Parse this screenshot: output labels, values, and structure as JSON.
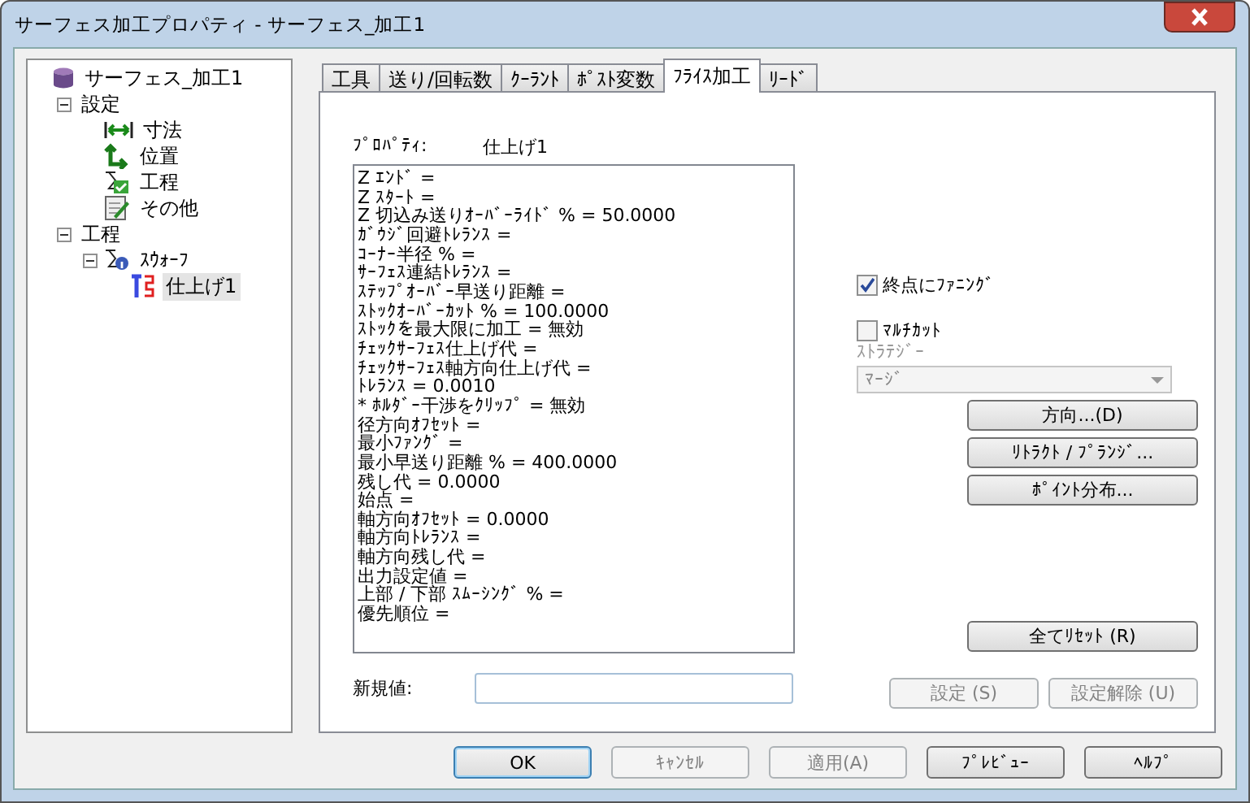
{
  "window": {
    "title": "サーフェス加工プロパティ - サーフェス_加工1"
  },
  "tree": [
    {
      "label": "サーフェス_加工1",
      "kind": "database",
      "selected": false,
      "children": [
        {
          "label": "設定",
          "expanded": true,
          "selected": false,
          "children": [
            {
              "label": "寸法",
              "kind": "dimension",
              "selected": false
            },
            {
              "label": "位置",
              "kind": "position",
              "selected": false
            },
            {
              "label": "工程",
              "kind": "process",
              "selected": false
            },
            {
              "label": "その他",
              "kind": "other",
              "selected": false
            }
          ]
        },
        {
          "label": "工程",
          "expanded": true,
          "selected": false,
          "children": [
            {
              "label": "ｽｳｫｰﾌ",
              "kind": "swarf",
              "expanded": true,
              "selected": false,
              "children": [
                {
                  "label": "仕上げ1",
                  "kind": "finish",
                  "selected": true
                }
              ]
            }
          ]
        }
      ]
    }
  ],
  "tabs": [
    {
      "label": "工具",
      "selected": false
    },
    {
      "label": "送り/回転数",
      "selected": false
    },
    {
      "label": "ｸｰﾗﾝﾄ",
      "selected": false
    },
    {
      "label": "ﾎﾟｽﾄ変数",
      "selected": false
    },
    {
      "label": "ﾌﾗｲｽ加工",
      "selected": true
    },
    {
      "label": "ﾘｰﾄﾞ",
      "selected": false
    }
  ],
  "property": {
    "label": "ﾌﾟﾛﾊﾟﾃｨ:",
    "value": "仕上げ1"
  },
  "properties": [
    "Z ｴﾝﾄﾞ =",
    "Z ｽﾀｰﾄ =",
    "Z 切込み送りｵｰﾊﾞｰﾗｲﾄﾞ % = 50.0000",
    "ｶﾞｳｼﾞ回避ﾄﾚﾗﾝｽ =",
    "ｺｰﾅｰ半径 % =",
    "ｻｰﾌｪｽ連結ﾄﾚﾗﾝｽ =",
    "ｽﾃｯﾌﾟｵｰﾊﾞｰ早送り距離 =",
    "ｽﾄｯｸｵｰﾊﾞｰｶｯﾄ % = 100.0000",
    "ｽﾄｯｸを最大限に加工 = 無効",
    "ﾁｪｯｸｻｰﾌｪｽ仕上げ代 =",
    "ﾁｪｯｸｻｰﾌｪｽ軸方向仕上げ代 =",
    "ﾄﾚﾗﾝｽ = 0.0010",
    "* ﾎﾙﾀﾞｰ干渉をｸﾘｯﾌﾟ = 無効",
    "径方向ｵﾌｾｯﾄ =",
    "最小ﾌｧﾝｸﾞ =",
    "最小早送り距離 % = 400.0000",
    "残し代 = 0.0000",
    "始点 =",
    "軸方向ｵﾌｾｯﾄ = 0.0000",
    "軸方向ﾄﾚﾗﾝｽ =",
    "軸方向残し代 =",
    "出力設定値 =",
    "上部 / 下部 ｽﾑｰｼﾝｸﾞ % =",
    "優先順位 ="
  ],
  "new_value": {
    "label": "新規値:"
  },
  "fanning": {
    "label": "終点にﾌｧﾆﾝｸﾞ",
    "checked": true
  },
  "multicut": {
    "label": "ﾏﾙﾁｶｯﾄ",
    "checked": false
  },
  "strategy": {
    "label": "ｽﾄﾗﾃｼﾞｰ",
    "value": "ﾏｰｼﾞ",
    "disabled": true
  },
  "side_buttons": [
    {
      "label": "方向...(D)",
      "disabled": false
    },
    {
      "label": "ﾘﾄﾗｸﾄ / ﾌﾟﾗﾝｼﾞ...",
      "disabled": false
    },
    {
      "label": "ﾎﾟｲﾝﾄ分布...",
      "disabled": false
    }
  ],
  "reset_button": {
    "label": "全てﾘｾｯﾄ (R)",
    "disabled": false
  },
  "set_buttons": [
    {
      "label": "設定 (S)",
      "disabled": true
    },
    {
      "label": "設定解除 (U)",
      "disabled": true
    }
  ],
  "buttons": [
    {
      "label": "OK",
      "disabled": false,
      "default": true
    },
    {
      "label": "ｷｬﾝｾﾙ",
      "disabled": true,
      "default": false
    },
    {
      "label": "適用(A)",
      "disabled": true,
      "default": false
    },
    {
      "label": "ﾌﾟﾚﾋﾞｭｰ",
      "disabled": false,
      "default": false
    },
    {
      "label": "ﾍﾙﾌﾟ",
      "disabled": false,
      "default": false
    }
  ]
}
